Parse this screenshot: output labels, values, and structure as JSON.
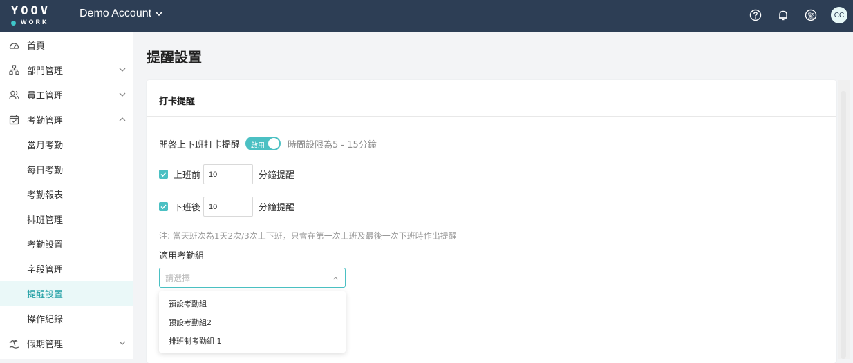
{
  "app": {
    "logo_top": "YOOV",
    "logo_bottom": "WORK",
    "account": "Demo Account",
    "avatar": "CC",
    "lang_badge": "繁"
  },
  "sidebar": {
    "items": [
      {
        "label": "首頁",
        "icon": "dashboard-icon"
      },
      {
        "label": "部門管理",
        "icon": "org-chart-icon"
      },
      {
        "label": "員工管理",
        "icon": "users-icon"
      },
      {
        "label": "考勤管理",
        "icon": "calendar-check-icon"
      }
    ],
    "sub_items": [
      "當月考勤",
      "每日考勤",
      "考勤報表",
      "排班管理",
      "考勤設置",
      "字段管理",
      "提醒設置",
      "操作紀錄"
    ],
    "last_item": {
      "label": "假期管理",
      "icon": "beach-icon"
    }
  },
  "page": {
    "title": "提醒設置",
    "card_title": "打卡提醒",
    "toggle_label": "開啓上下班打卡提醒",
    "toggle_state": "啟用",
    "toggle_hint": "時間設限為5 - 15分鐘",
    "before_work": {
      "label": "上班前",
      "value": "10",
      "unit": "分鐘提醒"
    },
    "after_work": {
      "label": "下班後",
      "value": "10",
      "unit": "分鐘提醒"
    },
    "note": "注: 當天班次為1天2次/3次上下班，只會在第一次上班及最後一次下班時作出提醒",
    "group_label": "適用考勤組",
    "select_placeholder": "請選擇",
    "options": [
      "預設考勤組",
      "預設考勤組2",
      "排班制考勤組 1"
    ]
  },
  "colors": {
    "topbar": "#2d3e55",
    "accent": "#4bc0c3",
    "active_bg": "#eaf8f8"
  }
}
